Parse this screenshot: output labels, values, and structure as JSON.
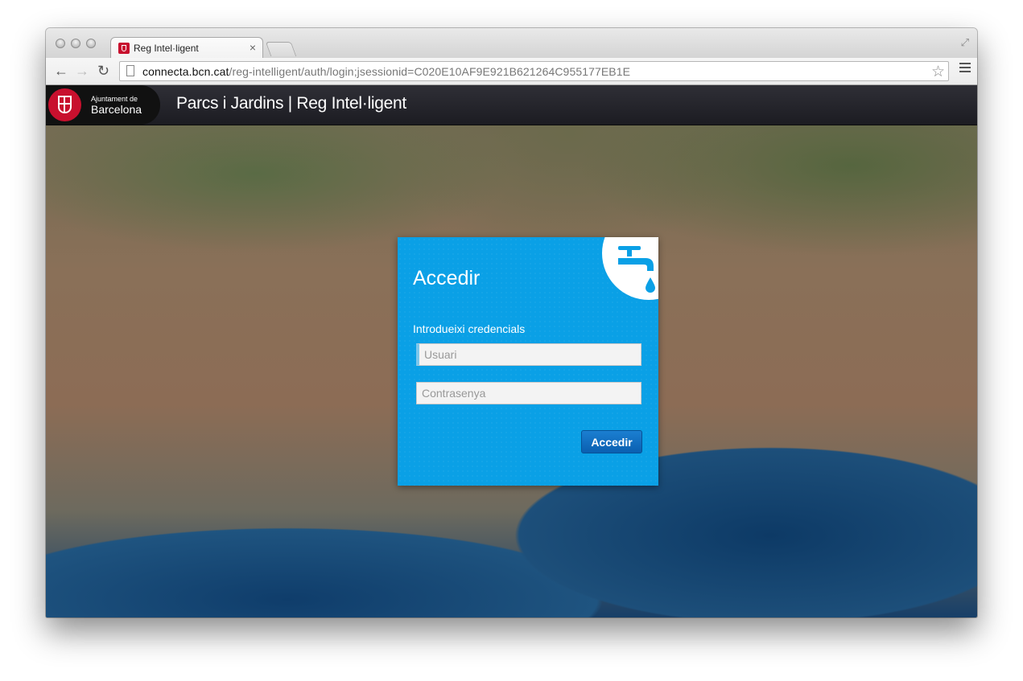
{
  "browser": {
    "tab_title": "Reg Intel·ligent",
    "tab_close": "×",
    "url_host": "connecta.bcn.cat",
    "url_path": "/reg-intelligent/auth/login;jsessionid=C020E10AF9E921B621264C955177EB1E"
  },
  "header": {
    "logo_small": "Ajuntament de",
    "logo_big": "Barcelona",
    "title": "Parcs i Jardins | Reg Intel·ligent"
  },
  "login": {
    "title": "Accedir",
    "credentials_label": "Introdueixi credencials",
    "username_placeholder": "Usuari",
    "password_placeholder": "Contrasenya",
    "submit_label": "Accedir"
  },
  "colors": {
    "card_background": "#0aa0e6",
    "brand_red": "#c8102e",
    "button_blue": "#0a5fb0"
  },
  "icons": {
    "tap": "water-tap-icon",
    "seal": "barcelona-seal-icon"
  }
}
